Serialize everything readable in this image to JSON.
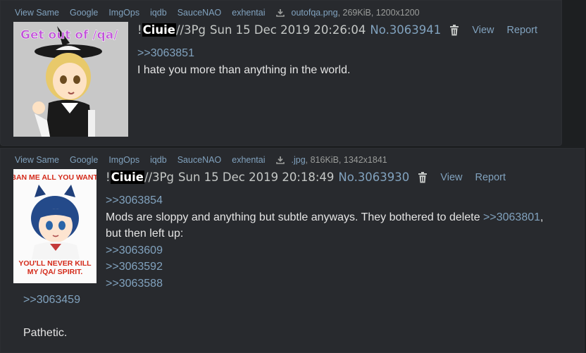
{
  "posts": [
    {
      "links": {
        "view_same": "View Same",
        "google": "Google",
        "imgops": "ImgOps",
        "iqdb": "iqdb",
        "saucenao": "SauceNAO",
        "exhentai": "exhentai",
        "filename": "outofqa.png",
        "fileinfo": ", 269KiB, 1200x1200"
      },
      "thumb_caption": "Get out of /qa/",
      "header": {
        "trip_prefix": "!",
        "trip_name": "Ciuie",
        "trip_suffix": "//3Pg",
        "datetime": "Sun 15 Dec 2019 20:26:04",
        "postno": "No.3063941",
        "view": "View",
        "report": "Report"
      },
      "body": {
        "quote": ">>3063851",
        "line1": "I hate you more than anything in the world."
      }
    },
    {
      "links": {
        "view_same": "View Same",
        "google": "Google",
        "imgops": "ImgOps",
        "iqdb": "iqdb",
        "saucenao": "SauceNAO",
        "exhentai": "exhentai",
        "filename": ".jpg",
        "fileinfo": ", 816KiB, 1342x1841"
      },
      "thumb_caption_top": "BAN ME ALL YOU WANT.",
      "thumb_caption_bottom": "YOU'LL NEVER KILL MY /QA/ SPIRIT.",
      "header": {
        "trip_prefix": "!",
        "trip_name": "Ciuie",
        "trip_suffix": "//3Pg",
        "datetime": "Sun 15 Dec 2019 20:18:49",
        "postno": "No.3063930",
        "view": "View",
        "report": "Report"
      },
      "body": {
        "quote1": ">>3063854",
        "line1": "Mods are sloppy and anything but subtle anyways. They bothered to delete ",
        "line1_link": ">>3063801",
        "line1_end": ",",
        "line2": "but then left up:",
        "quote2": ">>3063609",
        "quote3": ">>3063592",
        "quote4": ">>3063588",
        "quote5": ">>3063459",
        "line_last": "Pathetic."
      }
    }
  ],
  "icons": {
    "download": "download-icon",
    "trash": "trash-icon"
  },
  "colors": {
    "background": "#1d1f21",
    "post_bg": "#282a2e",
    "link": "#81a2be",
    "text": "#e4e4e4"
  }
}
